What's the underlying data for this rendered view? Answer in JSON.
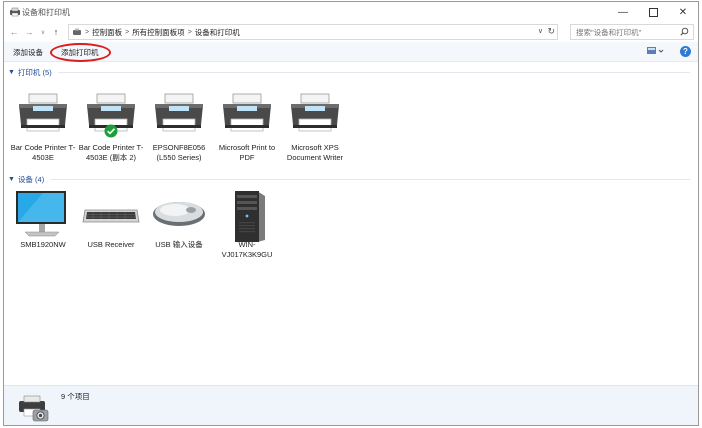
{
  "window": {
    "title": "设备和打印机"
  },
  "address": {
    "crumbs": [
      "控制面板",
      "所有控制面板项",
      "设备和打印机"
    ],
    "search_placeholder": "搜索\"设备和打印机\""
  },
  "toolbar": {
    "add_device": "添加设备",
    "add_printer": "添加打印机"
  },
  "groups": {
    "printers": {
      "title": "打印机 (5)",
      "items": [
        {
          "label": "Bar Code Printer T-4503E",
          "icon": "printer-icon"
        },
        {
          "label": "Bar Code Printer T-4503E (副本 2)",
          "icon": "printer-icon",
          "default": true
        },
        {
          "label": "EPSONF8E056 (L550 Series)",
          "icon": "printer-icon"
        },
        {
          "label": "Microsoft Print to PDF",
          "icon": "printer-icon"
        },
        {
          "label": "Microsoft XPS Document Writer",
          "icon": "printer-icon"
        }
      ]
    },
    "devices": {
      "title": "设备 (4)",
      "items": [
        {
          "label": "SMB1920NW",
          "icon": "monitor-icon"
        },
        {
          "label": "USB Receiver",
          "icon": "keyboard-icon"
        },
        {
          "label": "USB 输入设备",
          "icon": "mouse-icon"
        },
        {
          "label": "WIN-VJ017K3K9GU",
          "icon": "computer-tower-icon"
        }
      ]
    }
  },
  "status": {
    "count": "9 个项目"
  },
  "colors": {
    "accent": "#1f4e99",
    "highlight_oval": "#d81e1e",
    "check": "#1e9e3a"
  }
}
